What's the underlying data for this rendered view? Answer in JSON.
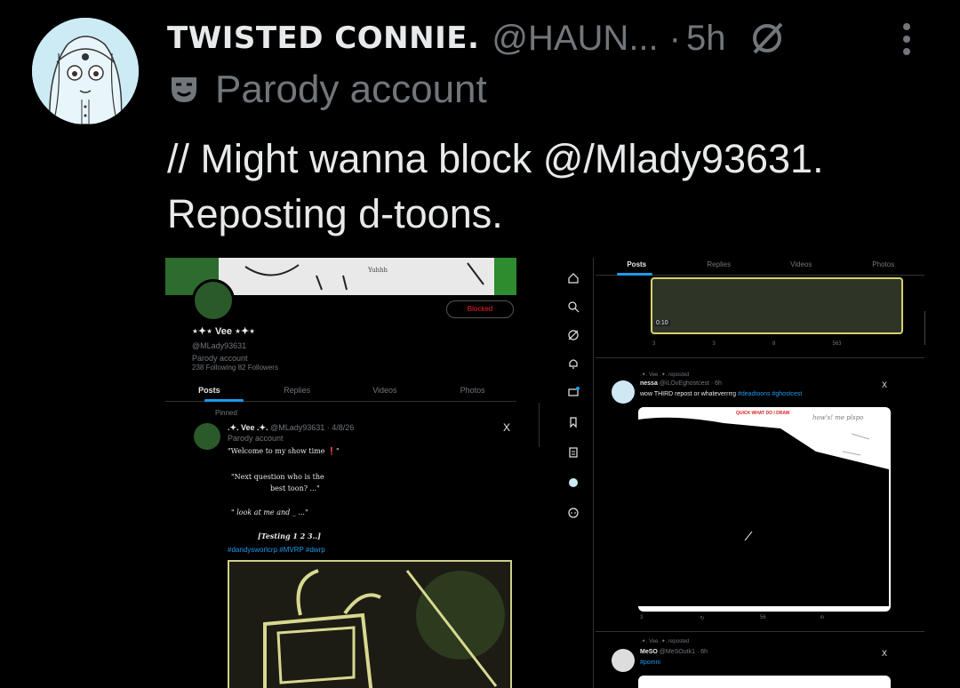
{
  "tweet": {
    "display_name": "TWISTED CONNIE.",
    "handle": "@HAUN...",
    "separator": "·",
    "time": "5h",
    "parody_label": "Parody account",
    "text_line1": "// Might wanna block @/Mlady93631.",
    "text_line2": "Reposting d-toons."
  },
  "left_screenshot": {
    "banner_scribble": "Yuhhh",
    "blocked_label": "Blocked",
    "profile_name": "⋆✦⋆ Vee ⋆✦⋆",
    "profile_handle": "@MLady93631",
    "parody_label": "Parody account",
    "follow_stats": "238 Following  82 Followers",
    "tabs": [
      "Posts",
      "Replies",
      "Videos",
      "Photos"
    ],
    "pinned_label": "Pinned",
    "post_name": ".✦. Vee .✦. ",
    "post_handle_date": "@MLady93631 · 4/8/26",
    "post_parody": "Parody account",
    "close_x": "X",
    "post_lines": [
      "\"Welcome to my show time ❗\"",
      "\"Next question who is the",
      "best toon? ...\"",
      "\" look at me and _ ...\"",
      "[Testing 1 2 3..]"
    ],
    "post_tags": "#dandysworlcrp #MVRP #dwrp"
  },
  "right_screenshot": {
    "tabs": [
      "Posts",
      "Replies",
      "Videos",
      "Photos"
    ],
    "video_time": "0:10",
    "actions_1": [
      "3",
      "3",
      "8",
      "563"
    ],
    "repost_1": ".✦. Vee .✦. reposted",
    "user_1_name": "nessa",
    "user_1_handle": "@iLOvEghostcest · 6h",
    "user_1_text": "wow THIRD repost or whateverrrrg ",
    "user_1_tags": "#deadtoons #ghostcest",
    "image_caption": "QUICK WHAT DO I DRAW",
    "image_handwriting": "how's! me plspo",
    "actions_2": [
      "3",
      "↻",
      "56",
      "ılı"
    ],
    "repost_2": ".✦. Vee .✦. reposted",
    "user_2_name": "MeSO",
    "user_2_handle": "@MeSOutk1 · 6h",
    "user_2_tags": "#pomni",
    "close_x": "X"
  }
}
